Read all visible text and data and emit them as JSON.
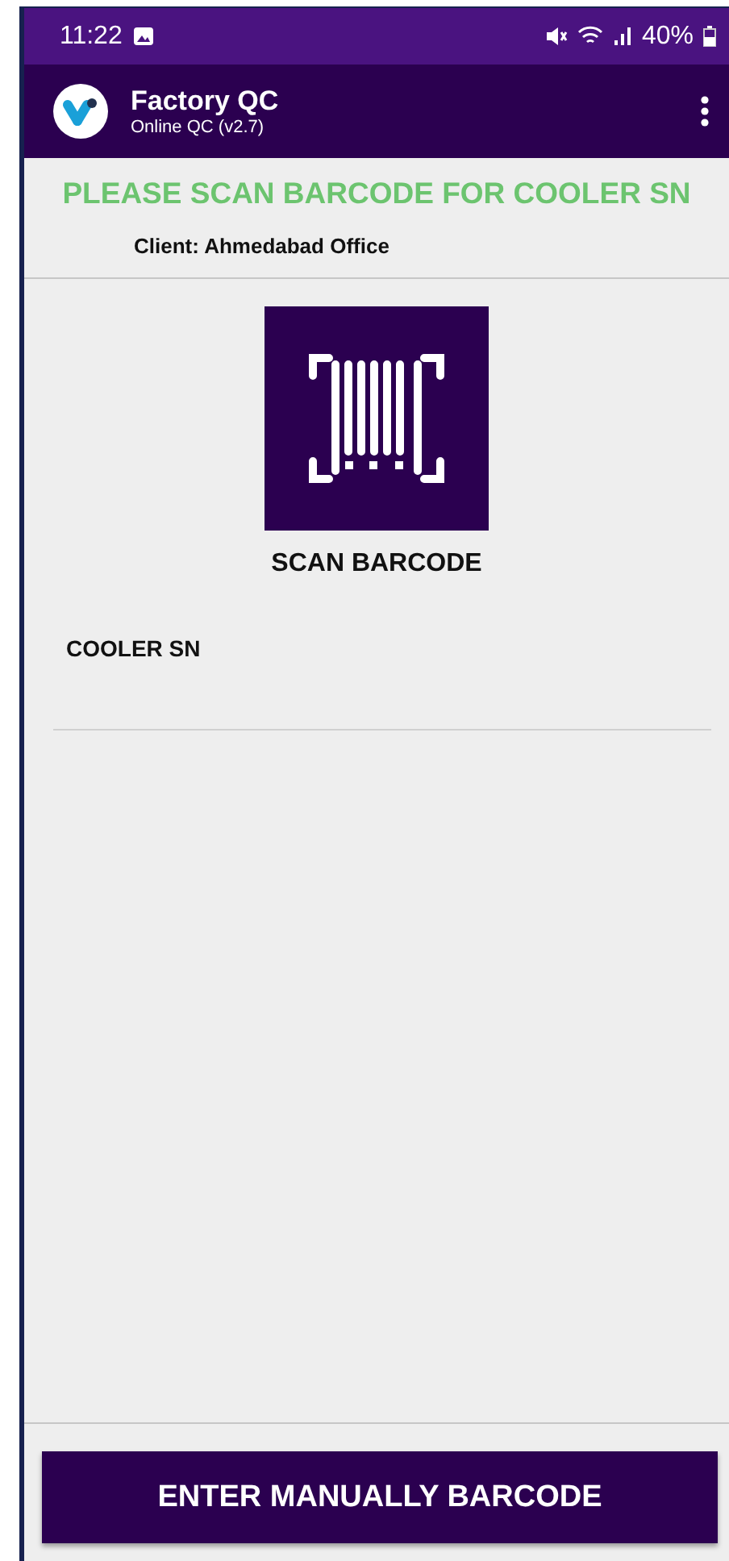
{
  "status_bar": {
    "time": "11:22",
    "battery": "40%"
  },
  "app_bar": {
    "title": "Factory QC",
    "subtitle": "Online QC (v2.7)"
  },
  "prompt": "PLEASE SCAN BARCODE FOR COOLER SN",
  "client": "Client: Ahmedabad Office",
  "scan_button": {
    "label": "SCAN BARCODE"
  },
  "field": {
    "label": "COOLER SN"
  },
  "bottom_button": {
    "label": "ENTER MANUALLY BARCODE"
  }
}
